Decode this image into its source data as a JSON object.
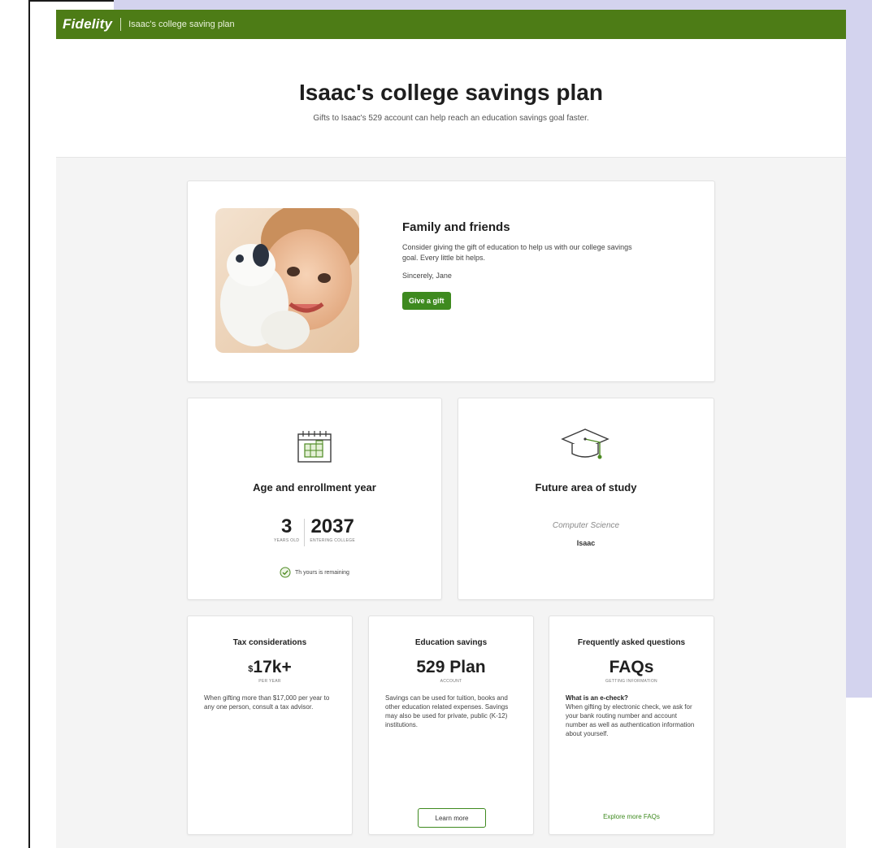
{
  "header": {
    "logo": "Fidelity",
    "title": "Isaac's college saving plan"
  },
  "hero": {
    "title": "Isaac's college savings plan",
    "subtitle": "Gifts to Isaac's 529 account can help reach an education savings goal faster."
  },
  "family": {
    "heading": "Family and friends",
    "message": "Consider giving the gift of education to help us with our college savings goal. Every little bit helps.",
    "signature": "Sincerely, Jane",
    "button": "Give a gift"
  },
  "age": {
    "heading": "Age and enrollment year",
    "age_value": "3",
    "age_label": "YEARS OLD",
    "year_value": "2037",
    "year_label": "ENTERING COLLEGE",
    "tracking_text": "Th yours is remaining"
  },
  "study": {
    "heading": "Future area of study",
    "field": "Computer Science",
    "name": "Isaac"
  },
  "tax": {
    "heading": "Tax considerations",
    "value_prefix": "$",
    "value": "17k+",
    "sub": "PER YEAR",
    "body": "When gifting more than $17,000 per year to any one person, consult a tax advisor."
  },
  "edu": {
    "heading": "Education savings",
    "value": "529 Plan",
    "sub": "ACCOUNT",
    "body": "Savings can be used for tuition, books and other education related expenses. Savings may also be used for private, public (K-12) institutions.",
    "button": "Learn more"
  },
  "faq": {
    "heading": "Frequently asked questions",
    "value": "FAQs",
    "sub": "GETTING INFORMATION",
    "question": "What is an e-check?",
    "answer": "When gifting by electronic check, we ask for your bank routing number and account number as well as authentication information about yourself.",
    "link": "Explore more FAQs"
  },
  "colors": {
    "brand_green": "#4d7c16",
    "button_green": "#3e8a1f"
  }
}
